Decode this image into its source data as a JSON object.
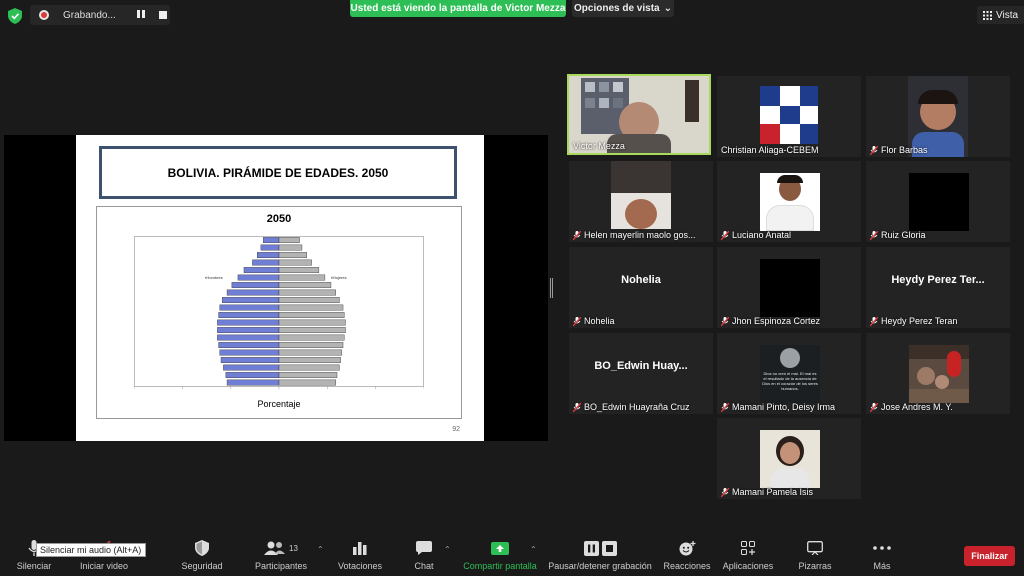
{
  "recording": {
    "label": "Grabando..."
  },
  "banner": {
    "text": "Usted está viendo la pantalla de Victor Mezza"
  },
  "view_options": {
    "label": "Opciones de vista"
  },
  "vista": {
    "label": "Vista"
  },
  "slide": {
    "title": "BOLIVIA. PIRÁMIDE DE EDADES. 2050",
    "chart_title": "2050",
    "xlabel": "Porcentaje",
    "left_legend": "▪Hombres",
    "right_legend": "▪Mujeres",
    "page": "92"
  },
  "chart_data": {
    "type": "bar",
    "orientation": "horizontal-pyramid",
    "title": "2050",
    "xlabel": "Porcentaje",
    "series": [
      {
        "name": "Hombres",
        "values": [
          1.3,
          1.5,
          1.8,
          2.2,
          2.9,
          3.4,
          3.9,
          4.3,
          4.7,
          4.9,
          5.0,
          5.1,
          5.1,
          5.1,
          5.0,
          4.9,
          4.8,
          4.6,
          4.4,
          4.3
        ]
      },
      {
        "name": "Mujeres",
        "values": [
          1.7,
          1.9,
          2.3,
          2.7,
          3.3,
          3.8,
          4.3,
          4.7,
          5.0,
          5.3,
          5.4,
          5.5,
          5.5,
          5.4,
          5.3,
          5.2,
          5.1,
          5.0,
          4.8,
          4.7
        ]
      }
    ],
    "xlim": [
      -12,
      12
    ],
    "grid": false
  },
  "colors": {
    "male": "#6f7fd6",
    "female": "#b3b3b3",
    "active": "#a8d85c",
    "finalizar": "#c8232d",
    "share": "#2dbe56"
  },
  "participants": [
    {
      "name": "Victor Mezza",
      "muted": false,
      "active": true
    },
    {
      "name": "Christian Aliaga-CEBEM",
      "muted": false
    },
    {
      "name": "Flor Barbas",
      "muted": true
    },
    {
      "name": "Helen mayerlin maolo gos...",
      "muted": true
    },
    {
      "name": "Luciano Anatal",
      "muted": true
    },
    {
      "name": "Ruiz Gloria",
      "muted": true
    },
    {
      "name": "Nohelia",
      "display": "Nohelia",
      "muted": true
    },
    {
      "name": "Jhon Espinoza Cortez",
      "muted": true
    },
    {
      "name": "Heydy Perez Teran",
      "display": "Heydy Perez Ter...",
      "muted": true
    },
    {
      "name": "BO_Edwin Huayraña Cruz",
      "display": "BO_Edwin Huay...",
      "muted": true
    },
    {
      "name": "Mamani Pinto, Deisy Irma",
      "muted": true,
      "quote": "Dios no creó el mal. El mal es el resultado de la ausencia de Dios en el corazón de los seres humanos."
    },
    {
      "name": "Jose Andres M. Y.",
      "muted": true
    },
    {
      "name": "Mamani Pamela Isis",
      "muted": true
    }
  ],
  "toolbar": {
    "mute": "Silenciar",
    "video": "Iniciar video",
    "security": "Seguridad",
    "participants": "Participantes",
    "participants_count": "13",
    "polls": "Votaciones",
    "chat": "Chat",
    "share": "Compartir pantalla",
    "pause_rec": "Pausar/detener grabación",
    "reactions": "Reacciones",
    "apps": "Aplicaciones",
    "whiteboards": "Pizarras",
    "more": "Más",
    "end": "Finalizar",
    "tooltip": "Silenciar mi audio (Alt+A)"
  }
}
